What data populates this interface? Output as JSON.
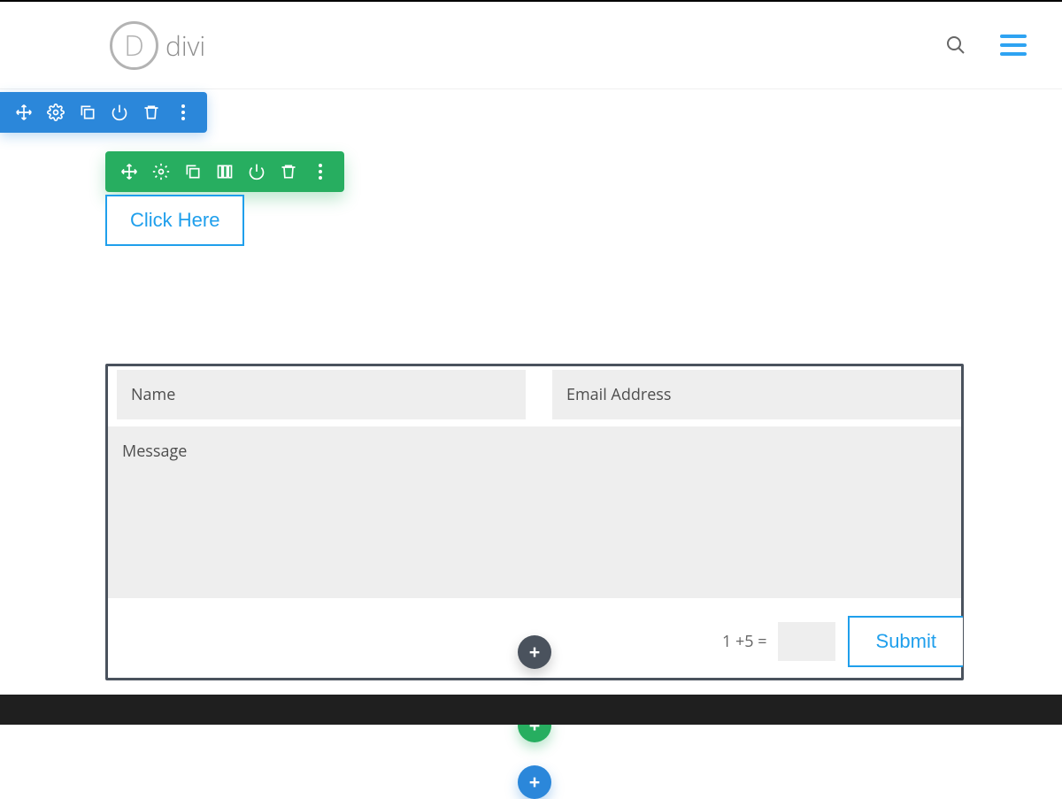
{
  "header": {
    "brand": "divi"
  },
  "button": {
    "click_here": "Click Here"
  },
  "form": {
    "name_ph": "Name",
    "email_ph": "Email Address",
    "message_ph": "Message",
    "captcha": "1 +5 =",
    "submit": "Submit"
  },
  "icons": {
    "plus": "+"
  }
}
